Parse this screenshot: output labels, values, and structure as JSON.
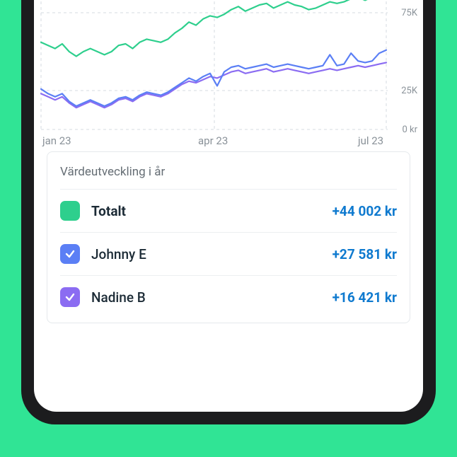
{
  "chart_data": {
    "type": "line",
    "x_categories": [
      "jan 23",
      "apr 23",
      "jul 23"
    ],
    "y_ticks": [
      0,
      25000,
      75000
    ],
    "y_tick_labels": [
      "0 kr",
      "25K",
      "75K"
    ],
    "xlim": [
      "jan 23",
      "jul 23"
    ],
    "ylim": [
      0,
      90000
    ],
    "title": "",
    "series": [
      {
        "name": "Totalt",
        "color": "#2ecf8d",
        "values": [
          56000,
          54000,
          52000,
          55000,
          50000,
          47000,
          50000,
          52000,
          50000,
          48000,
          50000,
          54000,
          55000,
          52000,
          56000,
          58000,
          57000,
          56000,
          58000,
          62000,
          65000,
          69000,
          67000,
          71000,
          73000,
          72000,
          74000,
          77000,
          79000,
          76000,
          78000,
          80000,
          81000,
          78000,
          80000,
          82000,
          80000,
          79000,
          77000,
          78000,
          80000,
          82000,
          81000,
          82000,
          84000,
          85000,
          83000,
          85000,
          87000,
          88000
        ]
      },
      {
        "name": "Johnny E",
        "color": "#5b7ff5",
        "values": [
          26000,
          23000,
          21000,
          23000,
          18000,
          15000,
          17000,
          19000,
          17000,
          15000,
          17000,
          20000,
          21000,
          19000,
          22000,
          24000,
          23000,
          22000,
          24000,
          27000,
          30000,
          33000,
          31000,
          34000,
          36000,
          28000,
          37000,
          40000,
          41000,
          39000,
          40000,
          41000,
          42000,
          40000,
          41000,
          42000,
          41000,
          40000,
          39000,
          40000,
          41000,
          48000,
          41000,
          42000,
          49000,
          44000,
          43000,
          44000,
          49000,
          51000
        ]
      },
      {
        "name": "Nadine B",
        "color": "#8b6cf2",
        "values": [
          23000,
          21000,
          19000,
          21000,
          17000,
          14000,
          16000,
          18000,
          16000,
          14000,
          16000,
          19000,
          20000,
          18000,
          21000,
          23000,
          22000,
          21000,
          23000,
          26000,
          29000,
          31000,
          30000,
          32000,
          34000,
          33000,
          35000,
          37000,
          38000,
          36000,
          37000,
          38000,
          39000,
          37000,
          38000,
          39000,
          38000,
          37000,
          36000,
          37000,
          38000,
          39000,
          38000,
          39000,
          40000,
          41000,
          40000,
          41000,
          42000,
          43000
        ]
      }
    ]
  },
  "y_axis": {
    "tick_75k": "75K",
    "tick_25k": "25K",
    "tick_0": "0 kr"
  },
  "x_axis": {
    "jan": "jan 23",
    "apr": "apr 23",
    "jul": "jul 23"
  },
  "legend": {
    "title": "Värdeutveckling i år",
    "rows": [
      {
        "name": "Totalt",
        "value": "+44 002 kr"
      },
      {
        "name": "Johnny E",
        "value": "+27 581 kr"
      },
      {
        "name": "Nadine B",
        "value": "+16 421 kr"
      }
    ]
  },
  "colors": {
    "total": "#2ecf8d",
    "johnny": "#5b7ff5",
    "nadine": "#8b6cf2",
    "value": "#0f7acf"
  }
}
